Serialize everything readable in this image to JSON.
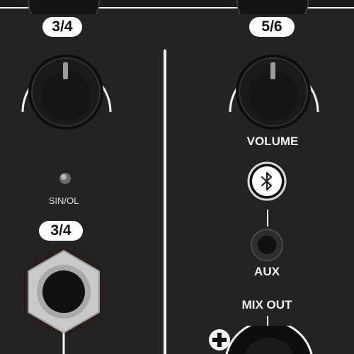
{
  "channel_left": {
    "gain_label": "3/4",
    "signal_led_label": "SIN/OL",
    "input_label": "3/4"
  },
  "channel_right": {
    "knob_label": "5/6",
    "volume_label": "VOLUME",
    "aux_label": "AUX",
    "mix_out_label": "MIX OUT"
  },
  "icons": {
    "bluetooth": "bluetooth-icon",
    "plus": "plus-icon"
  },
  "colors": {
    "panel": "#232323",
    "print": "#f2f2f2",
    "led": "#8a8a8a"
  }
}
